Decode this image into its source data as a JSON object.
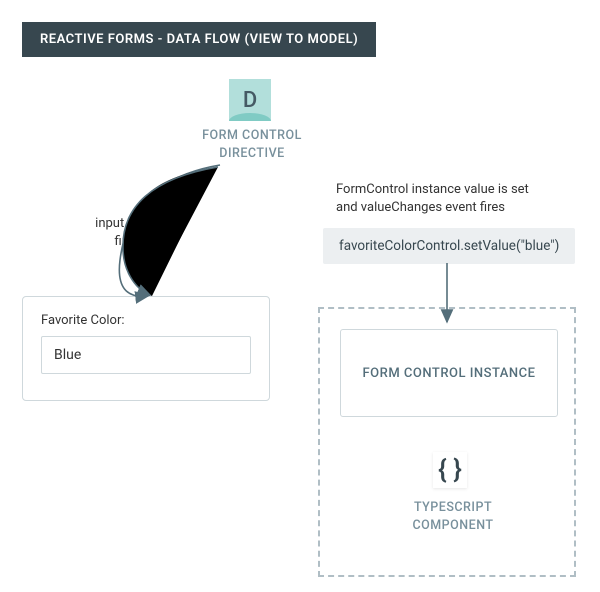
{
  "header": {
    "title": "REACTIVE FORMS - DATA FLOW (VIEW TO MODEL)"
  },
  "directive": {
    "letter": "D",
    "label_line1": "FORM CONTROL",
    "label_line2": "DIRECTIVE"
  },
  "annotations": {
    "value_set_line1": "FormControl instance value is set",
    "value_set_line2": "and valueChanges event fires",
    "input_event_line1": "input event",
    "input_event_line2": "fires"
  },
  "code": {
    "snippet": "favoriteColorControl.setValue(\"blue\")"
  },
  "form": {
    "label": "Favorite Color:",
    "value": "Blue"
  },
  "instance": {
    "label": "FORM CONTROL INSTANCE"
  },
  "typescript": {
    "braces": "{ }",
    "label_line1": "TYPESCRIPT",
    "label_line2": "COMPONENT"
  }
}
